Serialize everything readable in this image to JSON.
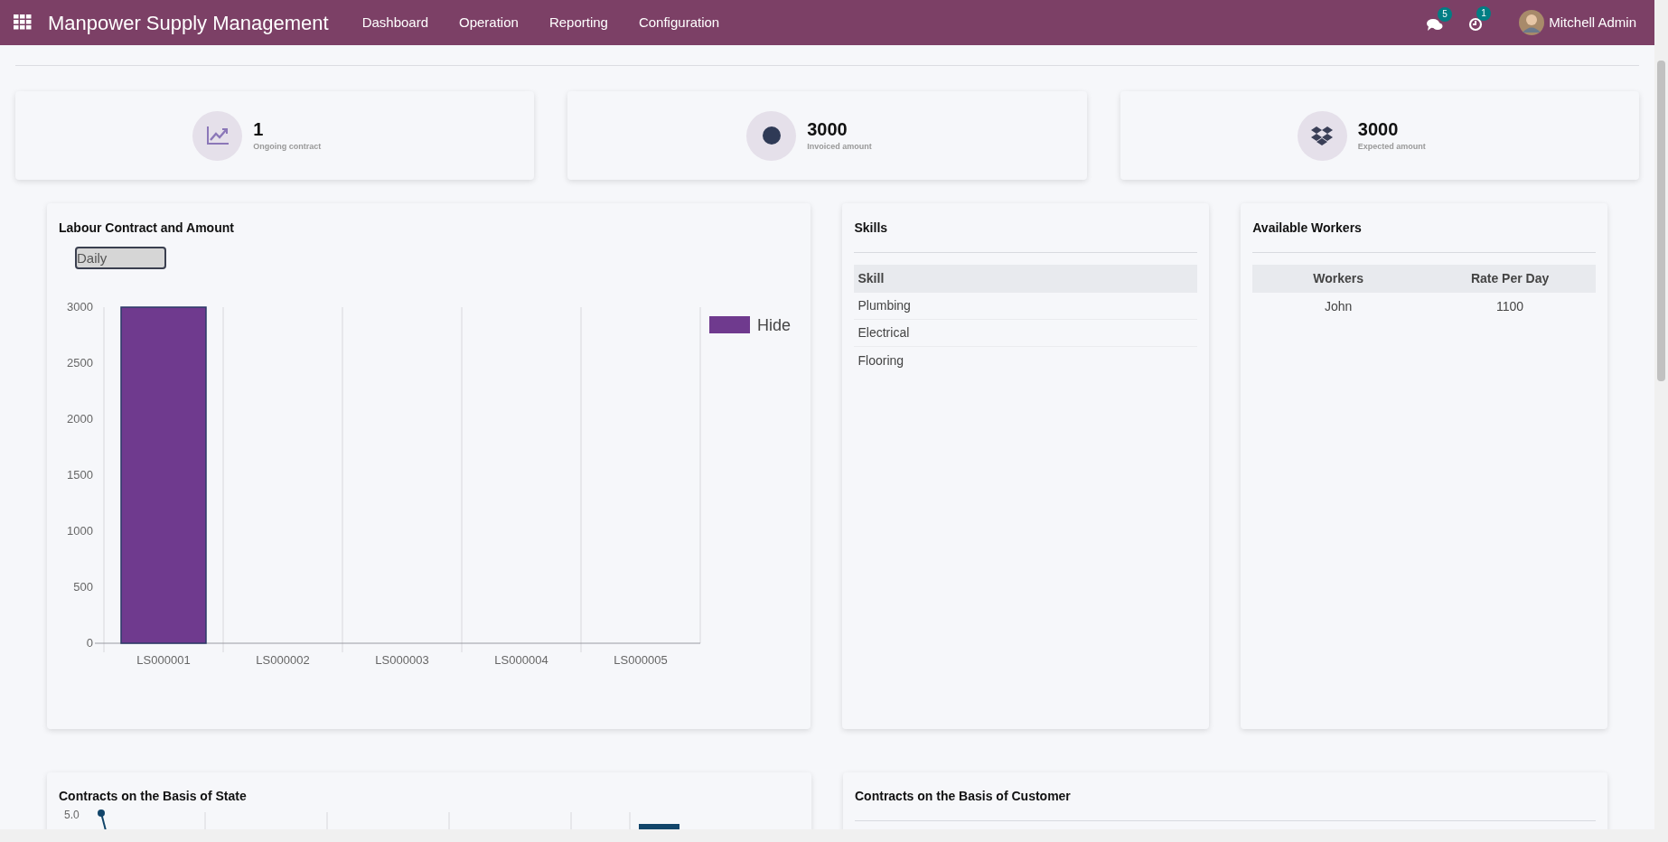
{
  "navbar": {
    "app_title": "Manpower Supply Management",
    "menu": [
      {
        "label": "Dashboard"
      },
      {
        "label": "Operation"
      },
      {
        "label": "Reporting"
      },
      {
        "label": "Configuration"
      }
    ],
    "messages_badge": "5",
    "activities_badge": "1",
    "user": "Mitchell Admin"
  },
  "stats": [
    {
      "kind": "chart",
      "value": "1",
      "label": "Ongoing contract"
    },
    {
      "kind": "dot",
      "value": "3000",
      "label": "Invoiced amount"
    },
    {
      "kind": "box",
      "value": "3000",
      "label": "Expected amount"
    }
  ],
  "labour_chart": {
    "title": "Labour Contract and Amount",
    "period": "Daily",
    "chart_data": {
      "type": "bar",
      "categories": [
        "LS000001",
        "LS000002",
        "LS000003",
        "LS000004",
        "LS000005"
      ],
      "series": [
        {
          "name": "Hide",
          "color": "#6f3a8e",
          "values": [
            3000,
            0,
            0,
            0,
            0
          ]
        }
      ],
      "ylim": [
        0,
        3000
      ],
      "yticks": [
        0,
        500,
        1000,
        1500,
        2000,
        2500,
        3000
      ]
    }
  },
  "skills": {
    "title": "Skills",
    "columns": [
      "Skill"
    ],
    "rows": [
      "Plumbing",
      "Electrical",
      "Flooring"
    ]
  },
  "workers": {
    "title": "Available Workers",
    "columns": [
      "Workers",
      "Rate Per Day"
    ],
    "rows": [
      [
        "John",
        "1100"
      ]
    ]
  },
  "state_chart": {
    "title": "Contracts on the Basis of State",
    "top_tick": "5.0"
  },
  "customer_chart": {
    "title": "Contracts on the Basis of Customer"
  }
}
